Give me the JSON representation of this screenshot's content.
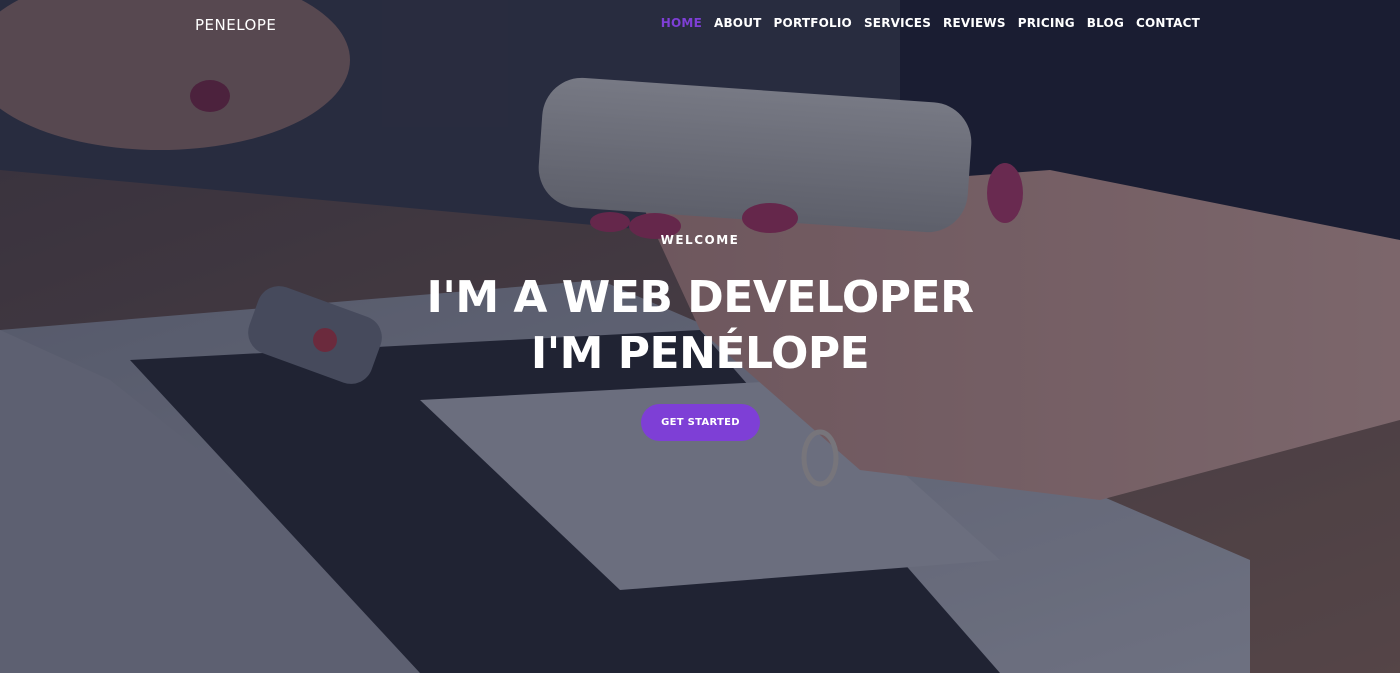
{
  "brand": "PENELOPE",
  "nav": {
    "items": [
      {
        "label": "HOME",
        "active": true
      },
      {
        "label": "ABOUT",
        "active": false
      },
      {
        "label": "PORTFOLIO",
        "active": false
      },
      {
        "label": "SERVICES",
        "active": false
      },
      {
        "label": "REVIEWS",
        "active": false
      },
      {
        "label": "PRICING",
        "active": false
      },
      {
        "label": "BLOG",
        "active": false
      },
      {
        "label": "CONTACT",
        "active": false
      }
    ]
  },
  "hero": {
    "eyebrow": "WELCOME",
    "headline_line1": "I'M A WEB DEVELOPER",
    "headline_line2": "I'M PENÉLOPE",
    "cta_label": "GET STARTED"
  },
  "colors": {
    "accent": "#7e3fd6",
    "text": "#ffffff",
    "overlay": "#141830"
  }
}
